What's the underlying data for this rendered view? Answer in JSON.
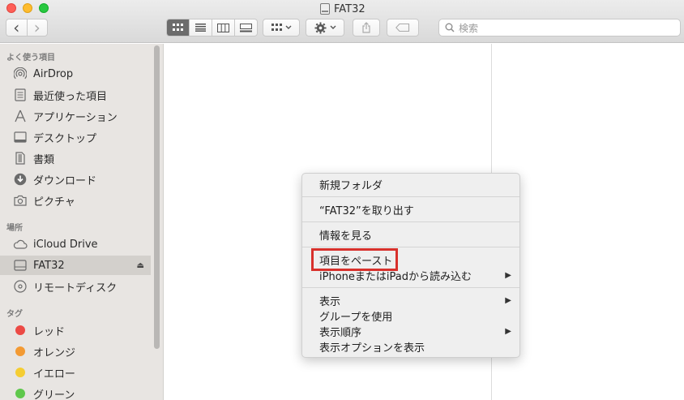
{
  "window": {
    "title": "FAT32"
  },
  "toolbar": {
    "back_icon": "‹",
    "forward_icon": "›",
    "view_icons": [
      "icon-view",
      "list-view",
      "column-view",
      "gallery-view"
    ],
    "search_placeholder": "検索"
  },
  "sidebar": {
    "favorites_header": "よく使う項目",
    "favorites": [
      {
        "label": "AirDrop",
        "icon": "airdrop-icon"
      },
      {
        "label": "最近使った項目",
        "icon": "recents-icon"
      },
      {
        "label": "アプリケーション",
        "icon": "applications-icon"
      },
      {
        "label": "デスクトップ",
        "icon": "desktop-icon"
      },
      {
        "label": "書類",
        "icon": "documents-icon"
      },
      {
        "label": "ダウンロード",
        "icon": "downloads-icon"
      },
      {
        "label": "ピクチャ",
        "icon": "pictures-icon"
      }
    ],
    "locations_header": "場所",
    "locations": [
      {
        "label": "iCloud Drive",
        "icon": "cloud-icon"
      },
      {
        "label": "FAT32",
        "icon": "drive-icon",
        "selected": true
      },
      {
        "label": "リモートディスク",
        "icon": "disc-icon"
      }
    ],
    "eject_icon": "⏏",
    "tags_header": "タグ",
    "tags": [
      {
        "label": "レッド",
        "color": "#ec4a45"
      },
      {
        "label": "オレンジ",
        "color": "#f39a33"
      },
      {
        "label": "イエロー",
        "color": "#f5cd32"
      },
      {
        "label": "グリーン",
        "color": "#5fc84c"
      }
    ]
  },
  "context_menu": {
    "items": [
      {
        "label": "新規フォルダ",
        "submenu": false
      },
      {
        "label": "“FAT32”を取り出す",
        "submenu": false
      },
      {
        "label": "情報を見る",
        "submenu": false
      },
      {
        "label": "項目をペースト",
        "submenu": false,
        "highlighted": true
      },
      {
        "label": "iPhoneまたはiPadから読み込む",
        "submenu": true
      },
      {
        "label": "表示",
        "submenu": true
      },
      {
        "label": "グループを使用",
        "submenu": false
      },
      {
        "label": "表示順序",
        "submenu": true
      },
      {
        "label": "表示オプションを表示",
        "submenu": false
      }
    ],
    "submenu_arrow": "▶",
    "highlight_color": "#d8312c"
  }
}
